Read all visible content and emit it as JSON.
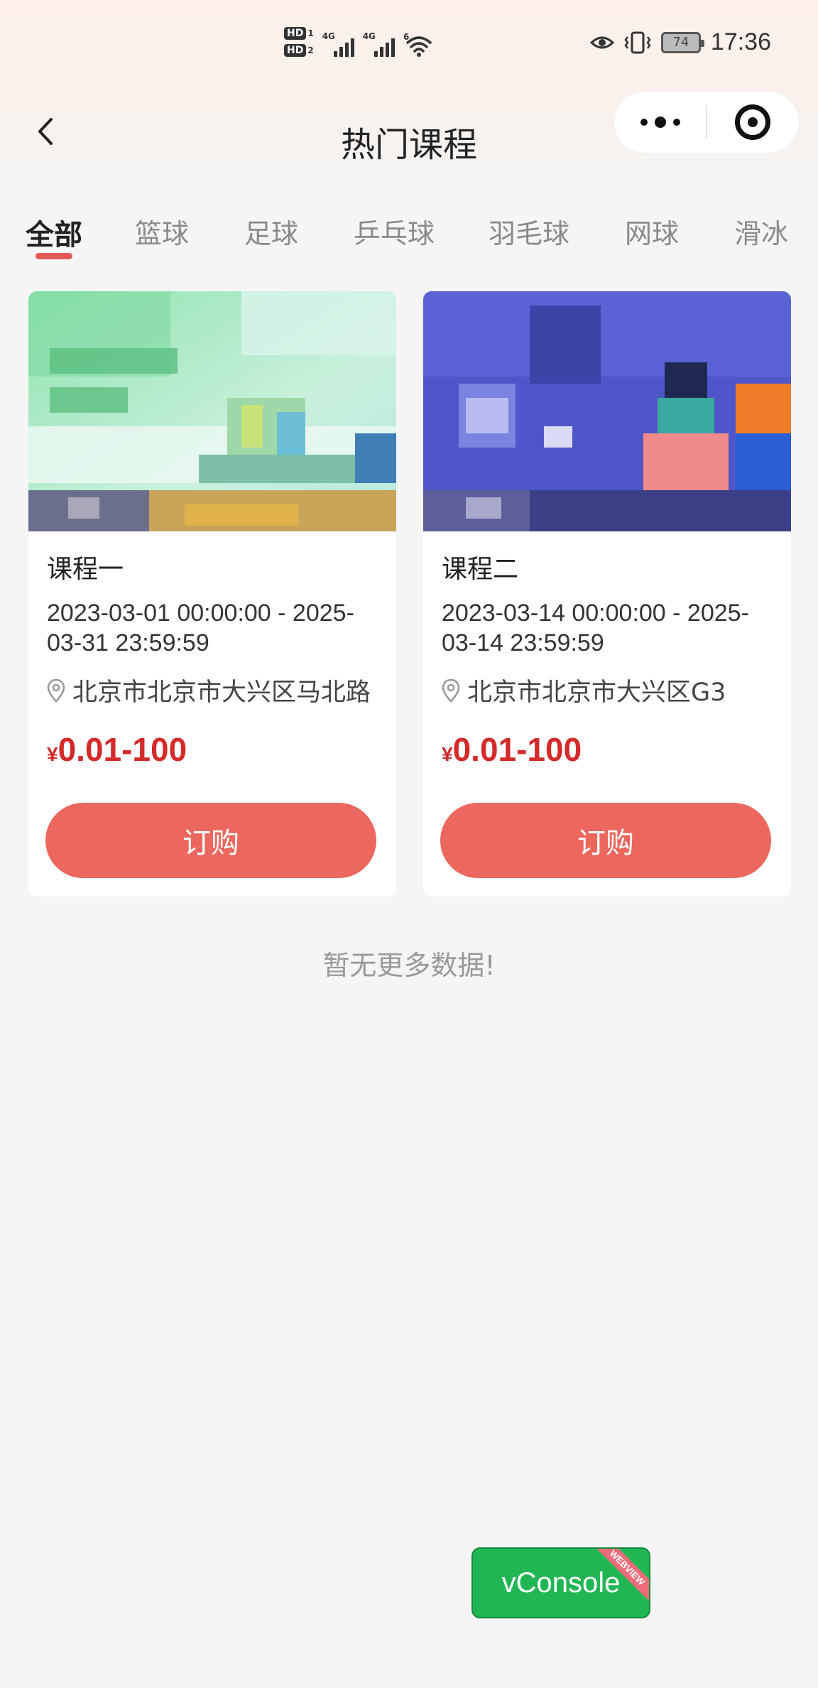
{
  "status_bar": {
    "hd1": "HD",
    "hd1_num": "1",
    "hd2": "HD",
    "hd2_num": "2",
    "sim1_type": "4G",
    "sim2_type": "4G",
    "wifi_label": "6",
    "battery": "74",
    "time": "17:36",
    "icons": [
      "eye-icon",
      "vibrate-icon",
      "wifi-icon",
      "signal-icon",
      "battery-icon"
    ]
  },
  "nav": {
    "title": "热门课程"
  },
  "tabs": [
    {
      "label": "全部",
      "active": true
    },
    {
      "label": "篮球",
      "active": false
    },
    {
      "label": "足球",
      "active": false
    },
    {
      "label": "乒乓球",
      "active": false
    },
    {
      "label": "羽毛球",
      "active": false
    },
    {
      "label": "网球",
      "active": false
    },
    {
      "label": "滑冰",
      "active": false
    }
  ],
  "courses": [
    {
      "name": "课程一",
      "time": "2023-03-01 00:00:00 - 2025-03-31 23:59:59",
      "location": "北京市北京市大兴区马北路",
      "currency": "¥",
      "price": "0.01-100",
      "button": "订购"
    },
    {
      "name": "课程二",
      "time": "2023-03-14 00:00:00 - 2025-03-14 23:59:59",
      "location": "北京市北京市大兴区G3",
      "currency": "¥",
      "price": "0.01-100",
      "button": "订购"
    }
  ],
  "footer": {
    "no_more": "暂无更多数据!"
  },
  "vconsole": {
    "label": "vConsole",
    "ribbon": "WEBVIEW"
  },
  "colors": {
    "accent": "#ec675d",
    "price": "#d42a2a",
    "tab_underline": "#e25a53",
    "vconsole": "#21b654"
  }
}
